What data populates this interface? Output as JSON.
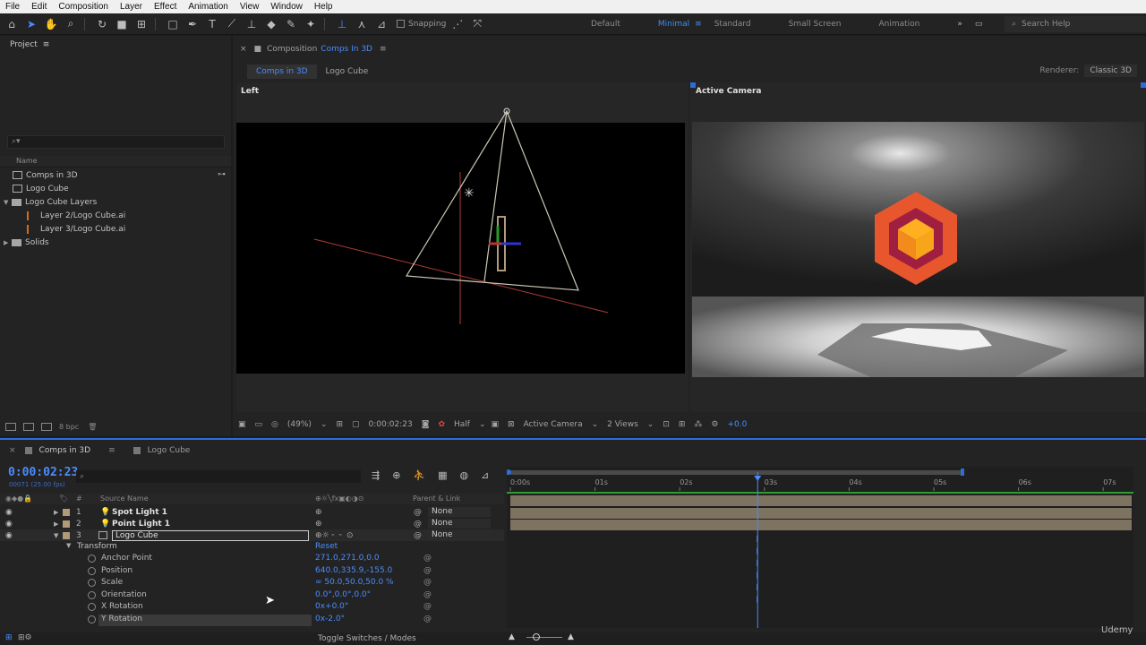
{
  "menu": [
    "File",
    "Edit",
    "Composition",
    "Layer",
    "Effect",
    "Animation",
    "View",
    "Window",
    "Help"
  ],
  "toolbar": {
    "snapping_label": "Snapping",
    "workspaces": [
      "Default",
      "Minimal",
      "Standard",
      "Small Screen",
      "Animation"
    ],
    "active_workspace": "Minimal",
    "search_placeholder": "Search Help",
    "overflow": "»"
  },
  "project": {
    "title": "Project",
    "search_placeholder": "",
    "column_name": "Name",
    "items": [
      {
        "label": "Comps in 3D",
        "type": "comp"
      },
      {
        "label": "Logo Cube",
        "type": "comp"
      },
      {
        "label": "Logo Cube Layers",
        "type": "folder"
      },
      {
        "label": "Layer 2/Logo Cube.ai",
        "type": "ai"
      },
      {
        "label": "Layer 3/Logo Cube.ai",
        "type": "ai"
      },
      {
        "label": "Solids",
        "type": "folder"
      }
    ],
    "bpc": "8 bpc"
  },
  "composition": {
    "header_prefix": "Composition",
    "name": "Comps In 3D",
    "tabs": [
      "Comps in 3D",
      "Logo Cube"
    ],
    "renderer_label": "Renderer:",
    "renderer_value": "Classic 3D",
    "left_view_label": "Left",
    "right_view_label": "Active Camera",
    "footer": {
      "zoom": "(49%)",
      "time": "0:00:02:23",
      "resolution": "Half",
      "camera": "Active Camera",
      "views": "2 Views",
      "exposure": "+0.0"
    }
  },
  "timeline": {
    "tabs": [
      "Comps in 3D",
      "Logo Cube"
    ],
    "timecode": "0:00:02:23",
    "fps": "00071 (25.00 fps)",
    "columns": {
      "hash": "#",
      "source": "Source Name",
      "parent": "Parent & Link"
    },
    "layers": [
      {
        "num": "1",
        "name": "Spot Light 1",
        "parent": "None"
      },
      {
        "num": "2",
        "name": "Point Light 1",
        "parent": "None"
      },
      {
        "num": "3",
        "name": "Logo Cube",
        "parent": "None"
      }
    ],
    "transform_label": "Transform",
    "reset_label": "Reset",
    "properties": [
      {
        "name": "Anchor Point",
        "value": "271.0,271.0,0.0"
      },
      {
        "name": "Position",
        "value": "640.0,335.9,-155.0"
      },
      {
        "name": "Scale",
        "value": "∞ 50.0,50.0,50.0 %"
      },
      {
        "name": "Orientation",
        "value": "0.0°,0.0°,0.0°"
      },
      {
        "name": "X Rotation",
        "value": "0x+0.0°"
      },
      {
        "name": "Y Rotation",
        "value": "0x-2.0°"
      }
    ],
    "ruler": [
      "0:00s",
      "01s",
      "02s",
      "03s",
      "04s",
      "05s",
      "06s",
      "07s"
    ],
    "playhead_seconds": 2.92,
    "footer_label": "Toggle Switches / Modes",
    "watermark": "Udemy"
  }
}
